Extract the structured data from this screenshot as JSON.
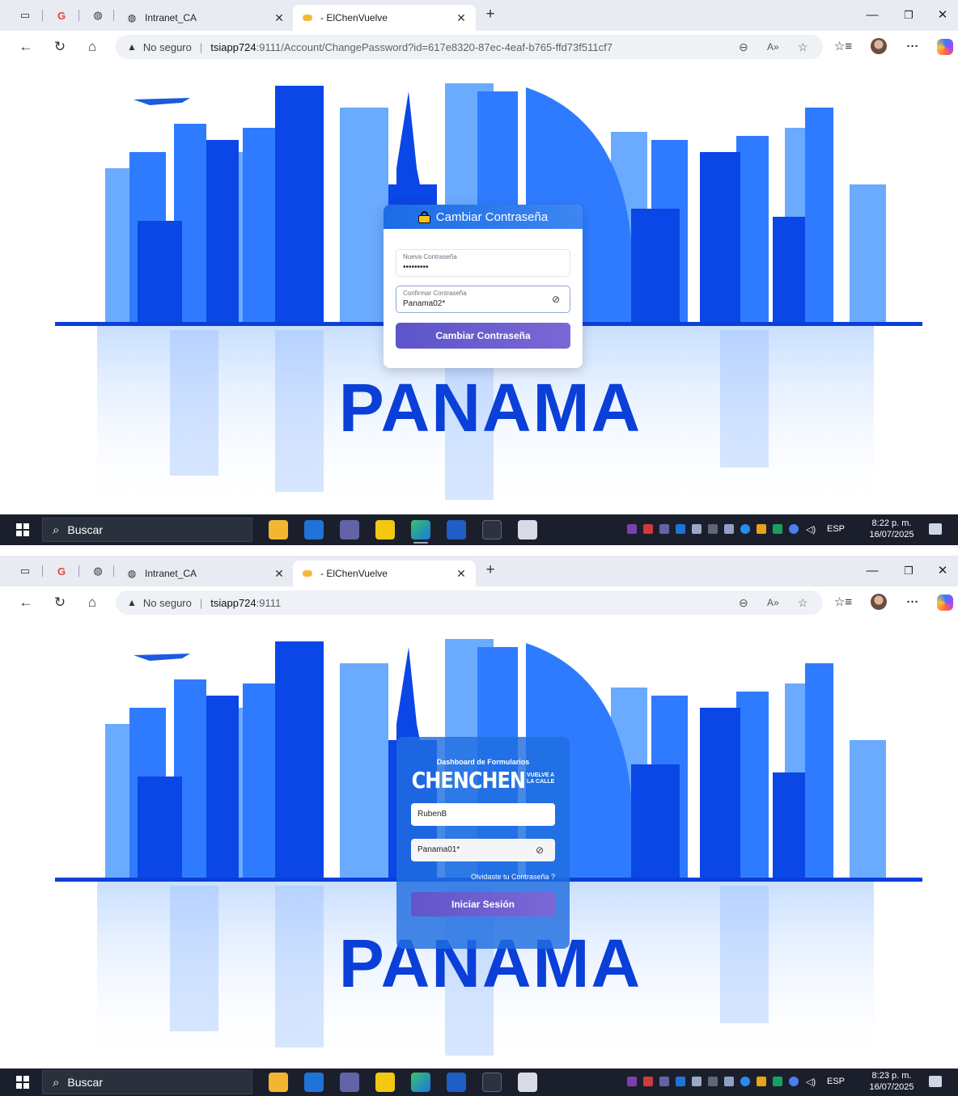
{
  "browser": {
    "tabs": [
      {
        "label": "Intranet_CA"
      },
      {
        "label": "- ElChenVuelve"
      }
    ]
  },
  "shot1": {
    "address": {
      "insecure": "No seguro",
      "host": "tsiapp724",
      "port_path": ":9111/Account/ChangePassword?id=617e8320-87ec-4eaf-b765-ffd73f511cf7"
    },
    "card": {
      "title": "Cambiar Contraseña",
      "new_label": "Nueva Contraseña",
      "new_value": "•••••••••",
      "confirm_label": "Confirmar Contraseña",
      "confirm_value": "Panama02*",
      "submit": "Cambiar Contraseña"
    },
    "banner_word": "PANAMA",
    "taskbar": {
      "search": "Buscar",
      "lang": "ESP",
      "time": "8:22 p. m.",
      "date": "16/07/2025"
    }
  },
  "shot2": {
    "address": {
      "insecure": "No seguro",
      "host": "tsiapp724",
      "port_path": ":9111"
    },
    "login": {
      "title": "Dashboard de Formularios",
      "logo_big": "CHENCHEN",
      "logo_small_1": "VUELVE A",
      "logo_small_2": "LA CALLE",
      "username": "RubenB",
      "password": "Panama01*",
      "forgot": "Olvidaste tu Contraseña ?",
      "submit": "Iniciar Sesión"
    },
    "banner_word": "PANAMA",
    "taskbar": {
      "search": "Buscar",
      "lang": "ESP",
      "time": "8:23 p. m.",
      "date": "16/07/2025"
    }
  },
  "colors": {
    "accent": "#1c6be6",
    "button": "#6a5fd0",
    "skyline_dark": "#0033cc",
    "skyline_light": "#5aa0ff"
  },
  "icons": [
    "tab-actions-icon",
    "google-icon",
    "globe-icon",
    "close-icon",
    "plus-icon",
    "minimize-icon",
    "restore-icon",
    "back-icon",
    "refresh-icon",
    "home-icon",
    "warning-icon",
    "zoom-icon",
    "read-aloud-icon",
    "favorite-icon",
    "collections-icon",
    "more-icon",
    "lock-icon",
    "eye-off-icon",
    "windows-icon",
    "search-icon"
  ]
}
